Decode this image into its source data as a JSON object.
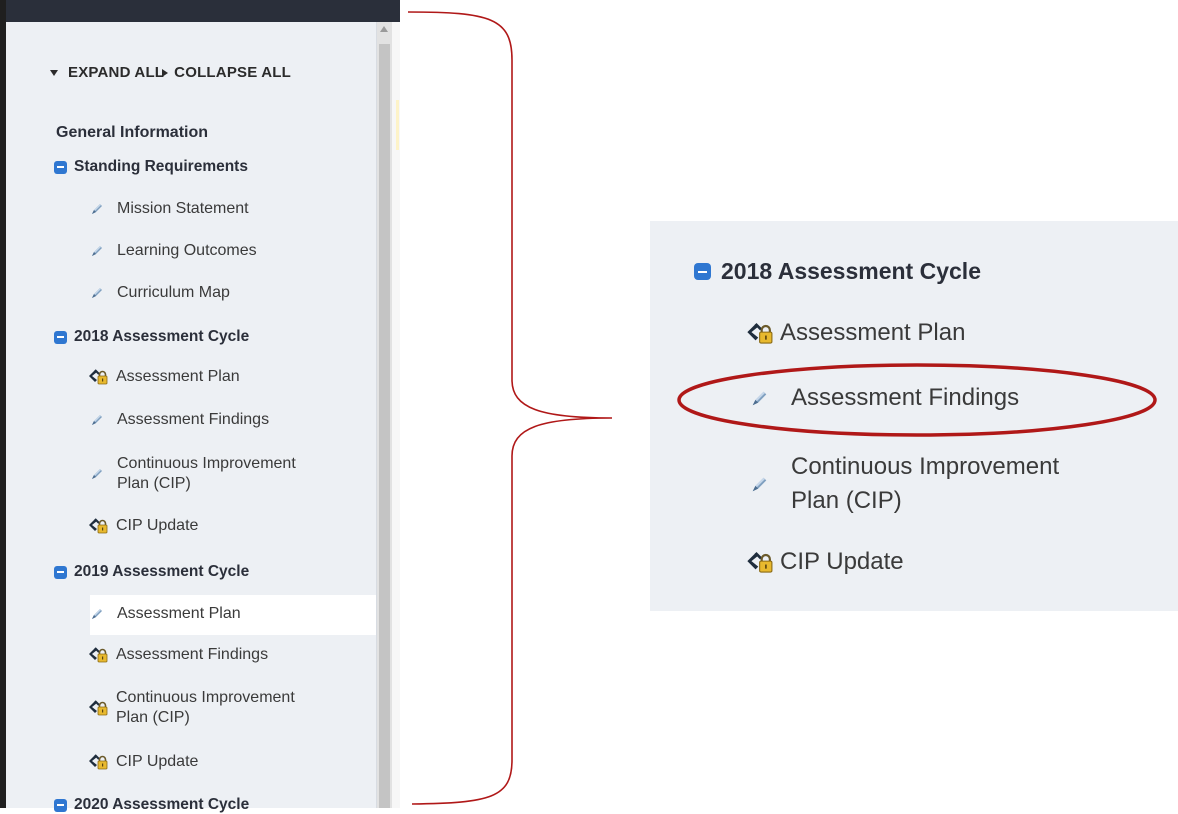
{
  "toolbar": {
    "expand_all": "EXPAND ALL",
    "collapse_all": "COLLAPSE ALL"
  },
  "sidebar": {
    "general": "General Information",
    "sections": [
      {
        "title": "Standing Requirements",
        "items": [
          "Mission Statement",
          "Learning Outcomes",
          "Curriculum Map"
        ]
      },
      {
        "title": "2018 Assessment Cycle",
        "items": [
          "Assessment Plan",
          "Assessment Findings",
          "Continuous Improvement",
          "Plan (CIP)",
          "CIP Update"
        ]
      },
      {
        "title": "2019 Assessment Cycle",
        "items": [
          "Assessment Plan",
          "Assessment Findings",
          "Continuous Improvement",
          "Plan (CIP)",
          "CIP Update"
        ]
      },
      {
        "title": "2020 Assessment Cycle"
      }
    ],
    "selected_item": "2019 Assessment Cycle / Assessment Plan"
  },
  "zoom": {
    "title": "2018 Assessment Cycle",
    "items": [
      "Assessment Plan",
      "Assessment Findings",
      "Continuous Improvement",
      "Plan (CIP)",
      "CIP Update"
    ],
    "highlighted": "Assessment Findings"
  },
  "colors": {
    "panel_bg": "#edf0f4",
    "accent_blue": "#2f77d1",
    "annotation_red": "#b01818"
  },
  "icons": {
    "editable": "pencil-icon",
    "locked": "lock-icon",
    "section": "minus-square-icon"
  }
}
